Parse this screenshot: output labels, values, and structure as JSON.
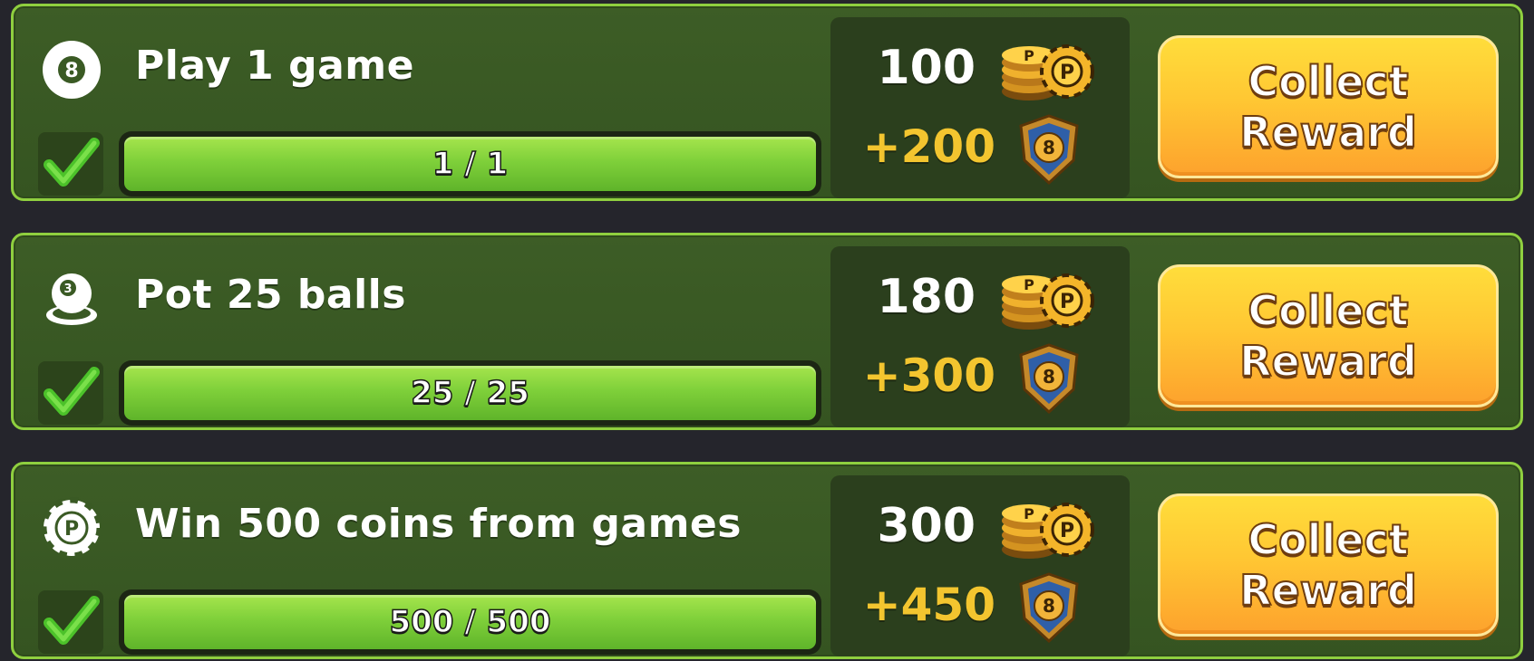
{
  "colors": {
    "row_background": "#3d5d26",
    "row_border": "#8fcf3f",
    "progress_fill": "#7fd03a",
    "xp_text": "#f3c52f",
    "button_top": "#ffdd3b",
    "button_bottom": "#fda22d"
  },
  "missions": [
    {
      "icon": "8-ball-icon",
      "title": "Play 1 game",
      "completed": true,
      "progress_text": "1 / 1",
      "progress_fraction": 1.0,
      "coins": "100",
      "coins_icon": "coin-stack-icon",
      "xp": "+200",
      "xp_icon": "8-ball-shield-icon",
      "button_label": "Collect Reward"
    },
    {
      "icon": "ball-pocket-icon",
      "title": "Pot 25 balls",
      "completed": true,
      "progress_text": "25 / 25",
      "progress_fraction": 1.0,
      "coins": "180",
      "coins_icon": "coin-stack-icon",
      "xp": "+300",
      "xp_icon": "8-ball-shield-icon",
      "button_label": "Collect Reward"
    },
    {
      "icon": "poker-chip-icon",
      "title": "Win 500 coins from games",
      "completed": true,
      "progress_text": "500 / 500",
      "progress_fraction": 1.0,
      "coins": "300",
      "coins_icon": "coin-stack-icon",
      "xp": "+450",
      "xp_icon": "8-ball-shield-icon",
      "button_label": "Collect Reward"
    }
  ]
}
